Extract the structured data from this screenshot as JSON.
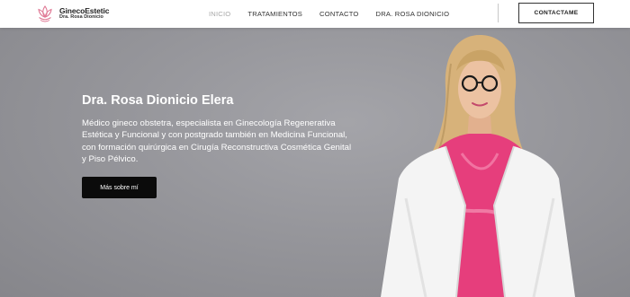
{
  "brand": {
    "name": "GinecoEstetic",
    "subtitle": "Dra. Rosa Dionicio",
    "accent": "#e07a96",
    "icon": "lotus-logo-icon"
  },
  "nav": {
    "items": [
      {
        "label": "INICIO",
        "active": true
      },
      {
        "label": "TRATAMIENTOS",
        "active": false
      },
      {
        "label": "CONTACTO",
        "active": false
      },
      {
        "label": "DRA. ROSA DIONICIO",
        "active": false
      }
    ],
    "cta": "CONTACTAME"
  },
  "hero": {
    "title": "Dra. Rosa Dionicio Elera",
    "description": "Médico gineco obstetra, especialista en Ginecología Regenerativa Estética y Funcional y con postgrado también en Medicina Funcional, con formación quirúrgica en Cirugía Reconstructiva Cosmética Genital y Piso Pélvico.",
    "button": "Más sobre mí",
    "background": "#96969b"
  },
  "colors": {
    "coat": "#f4f4f4",
    "scrubs": "#e63e7c",
    "hair": "#d7b27a"
  }
}
